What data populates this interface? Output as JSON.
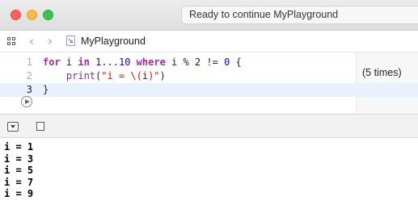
{
  "window": {
    "status": "Ready to continue MyPlayground"
  },
  "navbar": {
    "file_name": "MyPlayground",
    "icons": [
      "grid-icon",
      "chevron-left-icon",
      "chevron-right-icon",
      "swift-file-icon"
    ]
  },
  "editor": {
    "lines": [
      {
        "number": "1",
        "tokens": [
          {
            "t": "for",
            "c": "kw"
          },
          {
            "t": " i ",
            "c": "plain"
          },
          {
            "t": "in",
            "c": "kw"
          },
          {
            "t": " ",
            "c": "plain"
          },
          {
            "t": "1",
            "c": "num"
          },
          {
            "t": "...",
            "c": "plain"
          },
          {
            "t": "10",
            "c": "num"
          },
          {
            "t": " ",
            "c": "plain"
          },
          {
            "t": "where",
            "c": "kw"
          },
          {
            "t": " i % ",
            "c": "plain"
          },
          {
            "t": "2",
            "c": "num"
          },
          {
            "t": " != ",
            "c": "plain"
          },
          {
            "t": "0",
            "c": "num"
          },
          {
            "t": " {",
            "c": "plain"
          }
        ]
      },
      {
        "number": "2",
        "tokens": [
          {
            "t": "    ",
            "c": "plain"
          },
          {
            "t": "print",
            "c": "fn"
          },
          {
            "t": "(",
            "c": "plain"
          },
          {
            "t": "\"i = \\(",
            "c": "str"
          },
          {
            "t": "i",
            "c": "plain"
          },
          {
            "t": ")\"",
            "c": "str"
          },
          {
            "t": ")",
            "c": "plain"
          }
        ]
      },
      {
        "number": "3",
        "tokens": [
          {
            "t": "}",
            "c": "plain"
          }
        ]
      }
    ],
    "result_line2": "(5 times)",
    "run_icon": "play-circle-icon"
  },
  "debug": {
    "icons": [
      "hide-debug-area-icon",
      "console-toggle-icon"
    ]
  },
  "console": {
    "output": [
      "i = 1",
      "i = 3",
      "i = 5",
      "i = 7",
      "i = 9"
    ]
  },
  "colors": {
    "keyword": "#a626a4",
    "number": "#1c00cf",
    "string": "#c41a16",
    "function": "#6c36a9",
    "current_line": "#e9f1fd",
    "traffic_red": "#fc605c",
    "traffic_yellow": "#fdbc40",
    "traffic_green": "#34c84a"
  }
}
